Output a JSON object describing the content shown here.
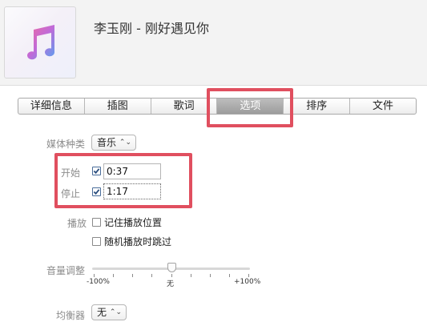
{
  "header": {
    "title": "李玉刚 - 刚好遇见你",
    "album_art_icon": "music-note-icon"
  },
  "tabs": [
    {
      "label": "详细信息",
      "selected": false
    },
    {
      "label": "插图",
      "selected": false
    },
    {
      "label": "歌词",
      "selected": false
    },
    {
      "label": "选项",
      "selected": true
    },
    {
      "label": "排序",
      "selected": false
    },
    {
      "label": "文件",
      "selected": false
    }
  ],
  "options": {
    "media_kind_label": "媒体种类",
    "media_kind_value": "音乐",
    "start_label": "开始",
    "start_checked": true,
    "start_value": "0:37",
    "stop_label": "停止",
    "stop_checked": true,
    "stop_value": "1:17",
    "playback_label": "播放",
    "remember_position_label": "记住播放位置",
    "remember_position_checked": false,
    "skip_shuffle_label": "随机播放时跳过",
    "skip_shuffle_checked": false,
    "volume_label": "音量调整",
    "volume_min_label": "-100%",
    "volume_mid_label": "无",
    "volume_max_label": "+100%",
    "volume_value_percent": 0,
    "eq_label": "均衡器",
    "eq_value": "无"
  },
  "colors": {
    "highlight": "#e04f5f",
    "selected_tab": "#a8a8a8",
    "checkbox_check": "#2b4e7e"
  }
}
